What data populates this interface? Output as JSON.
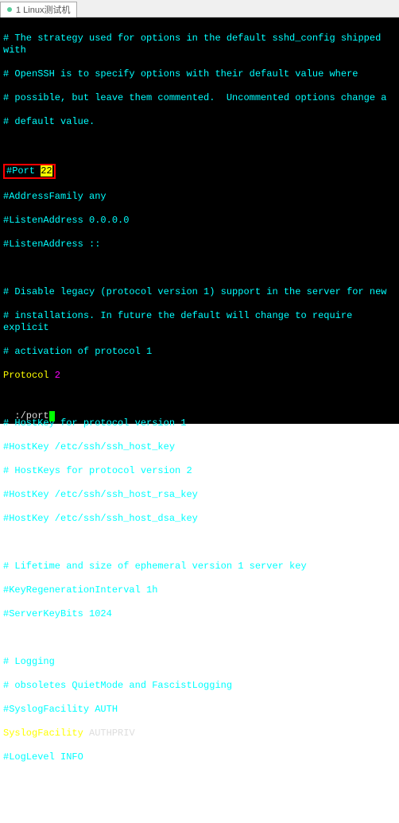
{
  "tab": {
    "label": "1 Linux测试机"
  },
  "config": {
    "comment_strategy_1": "# The strategy used for options in the default sshd_config shipped with",
    "comment_strategy_2": "# OpenSSH is to specify options with their default value where",
    "comment_strategy_3": "# possible, but leave them commented.  Uncommented options change a",
    "comment_strategy_4": "# default value.",
    "port_label": "#Port ",
    "port_value": "22",
    "address_family": "#AddressFamily any",
    "listen_address_1": "#ListenAddress 0.0.0.0",
    "listen_address_2": "#ListenAddress ::",
    "disable_legacy_1": "# Disable legacy (protocol version 1) support in the server for new",
    "disable_legacy_2": "# installations. In future the default will change to require explicit",
    "disable_legacy_3": "# activation of protocol 1",
    "protocol_label": "Protocol",
    "protocol_value": " 2",
    "hostkey_comment_v1": "# HostKey for protocol version 1",
    "hostkey_1": "#HostKey /etc/ssh/ssh_host_key",
    "hostkey_comment_v2": "# HostKeys for protocol version 2",
    "hostkey_2": "#HostKey /etc/ssh/ssh_host_rsa_key",
    "hostkey_3": "#HostKey /etc/ssh/ssh_host_dsa_key",
    "lifetime_comment": "# Lifetime and size of ephemeral version 1 server key",
    "key_regen": "#KeyRegenerationInterval 1h",
    "server_key_bits": "#ServerKeyBits 1024",
    "logging_comment": "# Logging",
    "obsoletes_comment": "# obsoletes QuietMode and FascistLogging",
    "syslog_facility_comment": "#SyslogFacility AUTH",
    "syslog_key": "SyslogFacility",
    "syslog_val": " AUTHPRIV",
    "loglevel": "#LogLevel INFO"
  },
  "status": {
    "search": ":/port"
  }
}
